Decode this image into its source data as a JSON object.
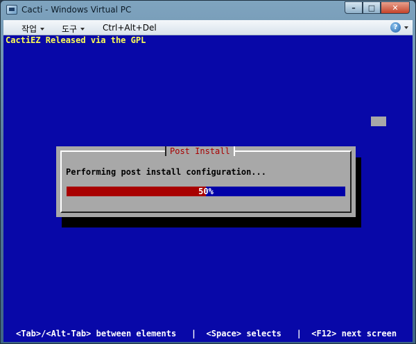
{
  "window": {
    "title": "Cacti - Windows Virtual PC",
    "minimize": "–",
    "maximize": "□",
    "close": "✕"
  },
  "menubar": {
    "items": [
      {
        "label": "작업"
      },
      {
        "label": "도구"
      }
    ],
    "ctrl_alt_del": "Ctrl+Alt+Del",
    "help": "?"
  },
  "console": {
    "banner": "CactiEZ Released via the GPL",
    "dialog": {
      "title": "Post Install",
      "message": "Performing post install configuration...",
      "progress_percent": 50,
      "progress_label": "50%"
    },
    "help_line": "<Tab>/<Alt-Tab> between elements   |  <Space> selects   |  <F12> next screen"
  },
  "colors": {
    "console_bg": "#0808a8",
    "banner_fg": "#ffff55",
    "dialog_bg": "#a8a8a8",
    "dialog_title_fg": "#a80000",
    "progress_fill": "#a80000",
    "progress_bg": "#0000a8"
  }
}
